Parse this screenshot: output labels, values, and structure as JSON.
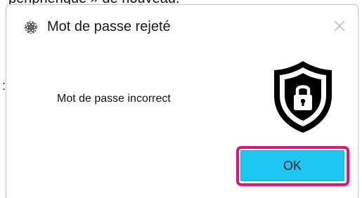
{
  "background": {
    "partial_text": "périphérique » de nouveau.",
    "colon": ":"
  },
  "dialog": {
    "title": "Mot de passe rejeté",
    "app_icon": "atom-gear-icon",
    "close_icon": "close-icon",
    "message": "Mot de passe incorrect",
    "status_icon": "shield-lock-icon",
    "ok_label": "OK"
  },
  "colors": {
    "ok_button": "#1ec6f3",
    "highlight": "#e0157d",
    "shield": "#000000"
  }
}
